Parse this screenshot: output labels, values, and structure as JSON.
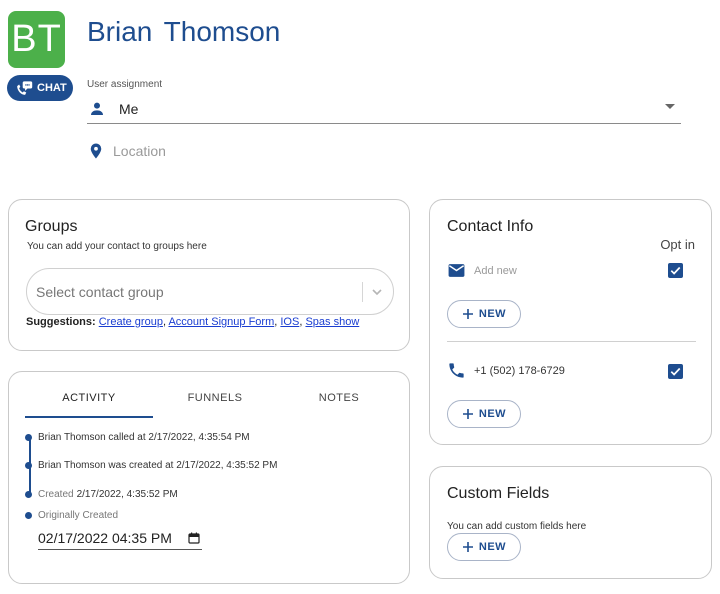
{
  "contact": {
    "initials": "BT",
    "first_name": "Brian",
    "last_name": "Thomson",
    "chat_label": "CHAT",
    "avatar_color": "#4cb04a"
  },
  "user_assignment": {
    "label": "User assignment",
    "value": "Me"
  },
  "location": {
    "placeholder": "Location"
  },
  "groups": {
    "title": "Groups",
    "subtitle": "You can add your contact to groups here",
    "select_placeholder": "Select contact group",
    "suggestions_label": "Suggestions:",
    "suggestions": [
      "Create group",
      "Account Signup Form",
      "IOS",
      "Spas show"
    ]
  },
  "activity": {
    "tabs": [
      "ACTIVITY",
      "FUNNELS",
      "NOTES"
    ],
    "active_tab": "ACTIVITY",
    "timeline": [
      "Brian Thomson called at 2/17/2022, 4:35:54 PM",
      "Brian Thomson was created at 2/17/2022, 4:35:52 PM"
    ],
    "created_label": "Created",
    "created_value": "2/17/2022, 4:35:52 PM",
    "originally_created_label": "Originally Created",
    "originally_created_value": "02/17/2022 04:35 PM"
  },
  "contact_info": {
    "title": "Contact Info",
    "opt_in_label": "Opt in",
    "email_placeholder": "Add new",
    "email_opt_in": true,
    "new_label": "NEW",
    "phone": "+1 (502) 178-6729",
    "phone_opt_in": true
  },
  "custom_fields": {
    "title": "Custom Fields",
    "subtitle": "You can add custom fields here",
    "new_label": "NEW"
  },
  "colors": {
    "primary": "#1e4d8f",
    "link": "#1a3dd1"
  }
}
